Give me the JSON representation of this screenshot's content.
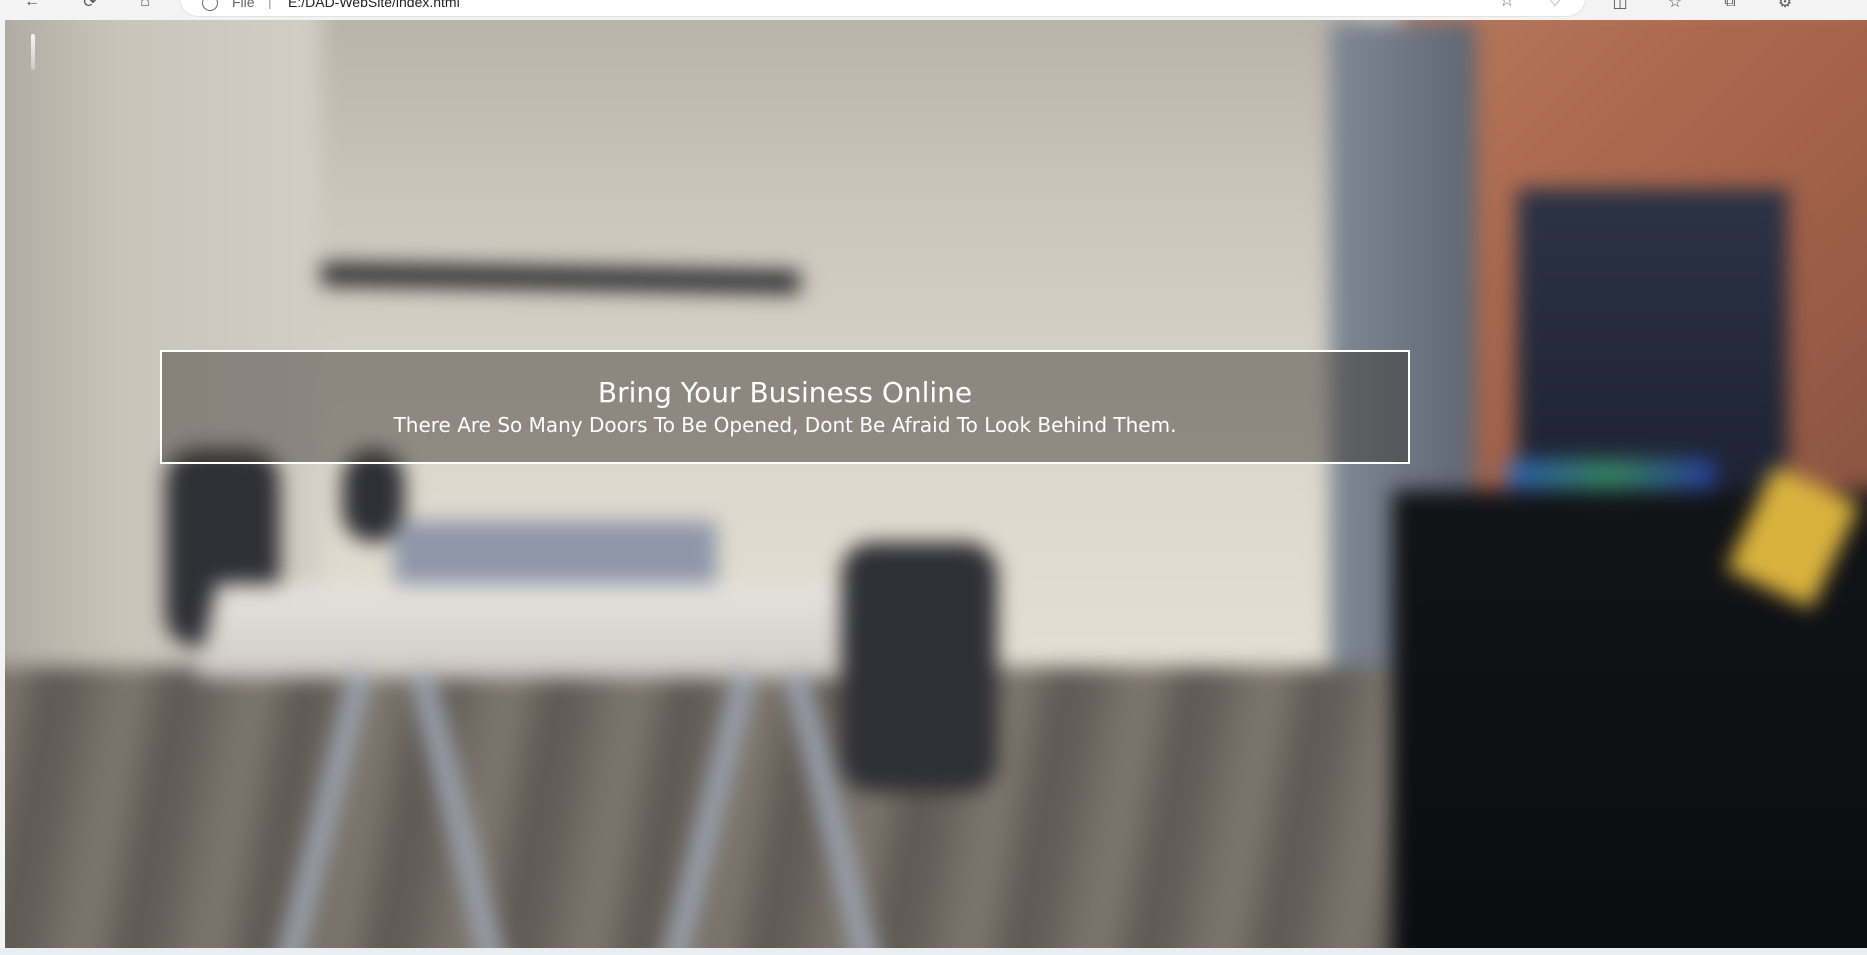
{
  "browser": {
    "address_protocol": "File",
    "address_separator": "|",
    "address_url": "E:/DAD-WebSite/index.html",
    "icons": {
      "back": "back-arrow-icon",
      "reload": "reload-icon",
      "home": "home-icon",
      "site_info": "info-icon",
      "favorite": "star-icon",
      "favorites_list": "favorites-icon",
      "split_screen": "split-screen-icon",
      "favorites_bar": "favorites-bar-icon",
      "collections": "collections-icon",
      "extensions": "extensions-icon"
    }
  },
  "hero": {
    "title": "Bring Your Business Online",
    "subtitle": "There Are So Many Doors To Be Opened, Dont Be Afraid To Look Behind Them."
  },
  "colors": {
    "hero_text": "#ffffff",
    "hero_border": "#ffffff",
    "hero_overlay": "#3c3732"
  }
}
